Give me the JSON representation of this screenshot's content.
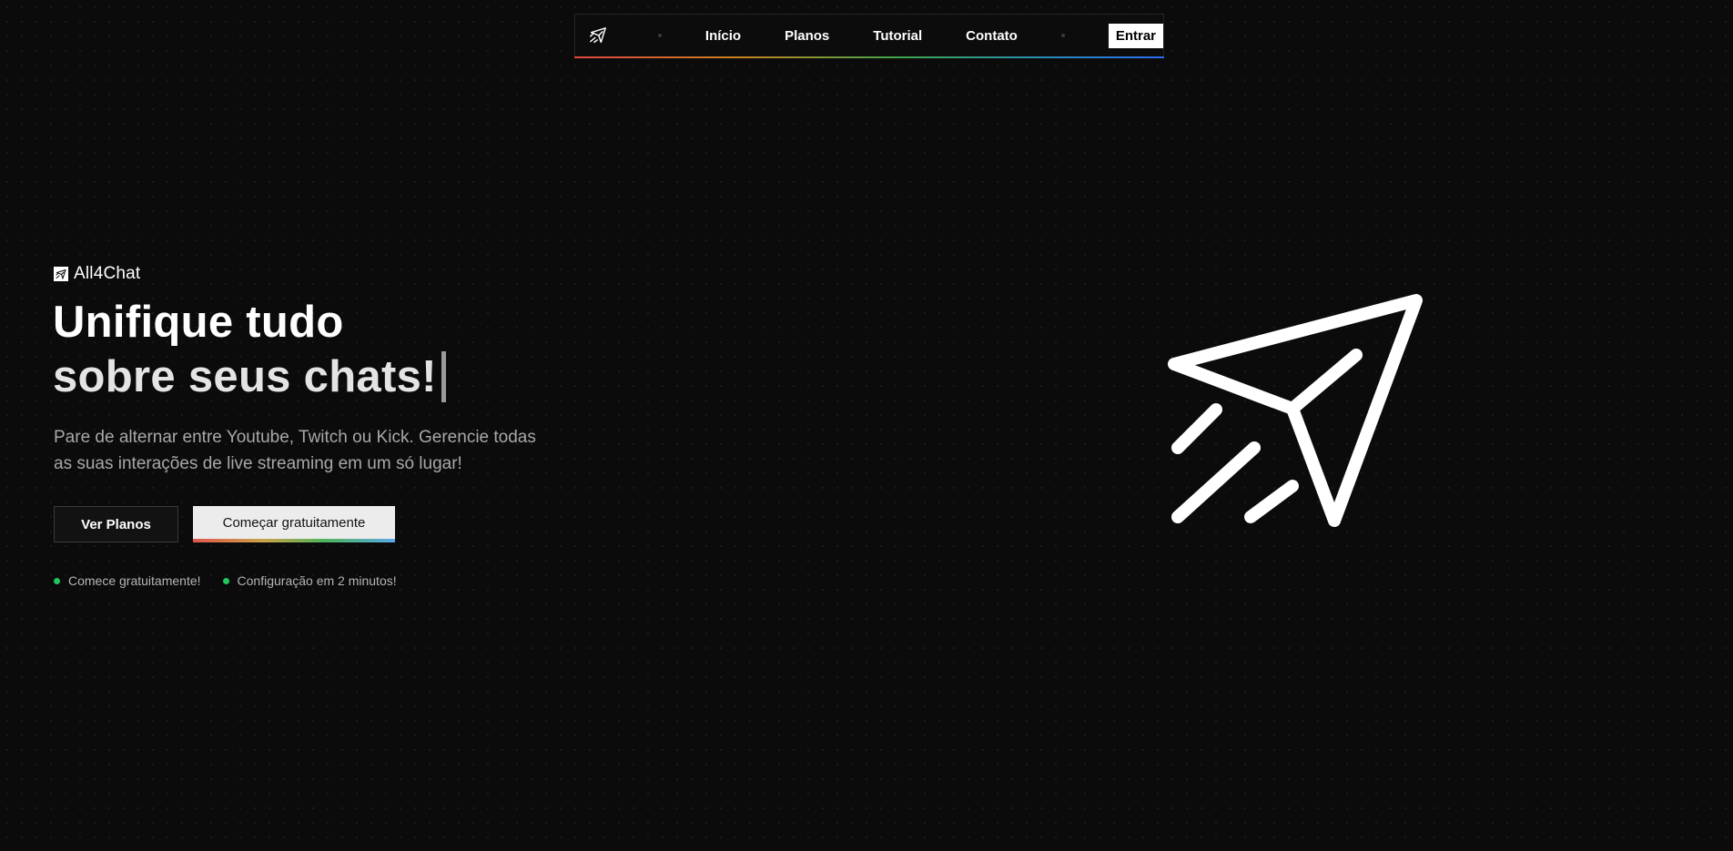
{
  "nav": {
    "logo_icon": "paper-plane-icon",
    "links": [
      "Início",
      "Planos",
      "Tutorial",
      "Contato"
    ],
    "login_label": "Entrar"
  },
  "hero": {
    "brand_name": "All4Chat",
    "brand_icon": "paper-plane-icon",
    "title_line1": "Unifique tudo",
    "title_line2": "sobre seus chats!",
    "subtitle": "Pare de alternar entre Youtube, Twitch ou Kick. Gerencie todas as suas interações de live streaming em um só lugar!",
    "buttons": {
      "plans_label": "Ver Planos",
      "start_label": "Começar gratuitamente"
    },
    "features": [
      "Comece gratuitamente!",
      "Configuração em 2 minutos!"
    ],
    "illustration_icon": "paper-plane-icon"
  },
  "colors": {
    "background": "#0b0b0c",
    "accent_green": "#22c55e",
    "nav_gradient": [
      "#e0453e",
      "#c9821f",
      "#3fa64a",
      "#2a8fb0",
      "#2a6cf0"
    ],
    "button_gradient": [
      "#e0574f",
      "#c9a34a",
      "#4fb35b",
      "#59a9e8"
    ]
  }
}
